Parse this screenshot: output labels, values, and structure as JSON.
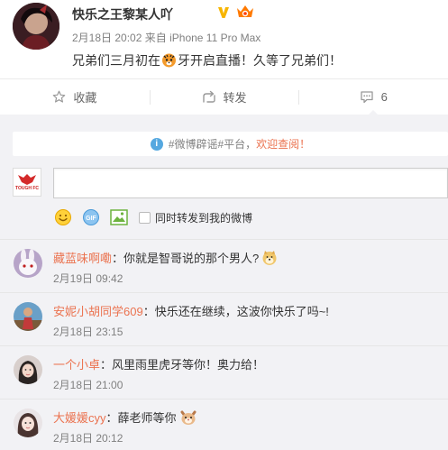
{
  "post": {
    "author": "快乐之王黎某人吖",
    "time": "2月18日 20:02",
    "source_prefix": "来自",
    "source": "iPhone 11 Pro Max",
    "text_before": "兄弟们三月初在",
    "text_after": "牙开启直播！久等了兄弟们！"
  },
  "actions": {
    "favorite": "收藏",
    "repost": "转发",
    "comment_count": "6"
  },
  "notice": {
    "text": "#微博辟谣#平台，",
    "link": "欢迎查阅！"
  },
  "composer": {
    "avatar_text": "TOUGH FC",
    "input_value": "",
    "repost_checkbox_label": "同时转发到我的微博"
  },
  "comments": [
    {
      "name": "藏蓝味啊嘞",
      "text": "你就是智哥说的那个男人?",
      "time": "2月19日 09:42"
    },
    {
      "name": "安妮小胡同学609",
      "text": "快乐还在继续，这波你快乐了吗~!",
      "time": "2月18日 23:15"
    },
    {
      "name": "一个小卓",
      "text": "风里雨里虎牙等你！奥力给！",
      "time": "2月18日 21:00"
    },
    {
      "name": "大媛媛cyy",
      "text": "薛老师等你",
      "time": "2月18日 20:12"
    }
  ],
  "colors": {
    "accent": "#eb7350",
    "verified": "#f7b500",
    "panel_bg": "#f2f2f5"
  }
}
